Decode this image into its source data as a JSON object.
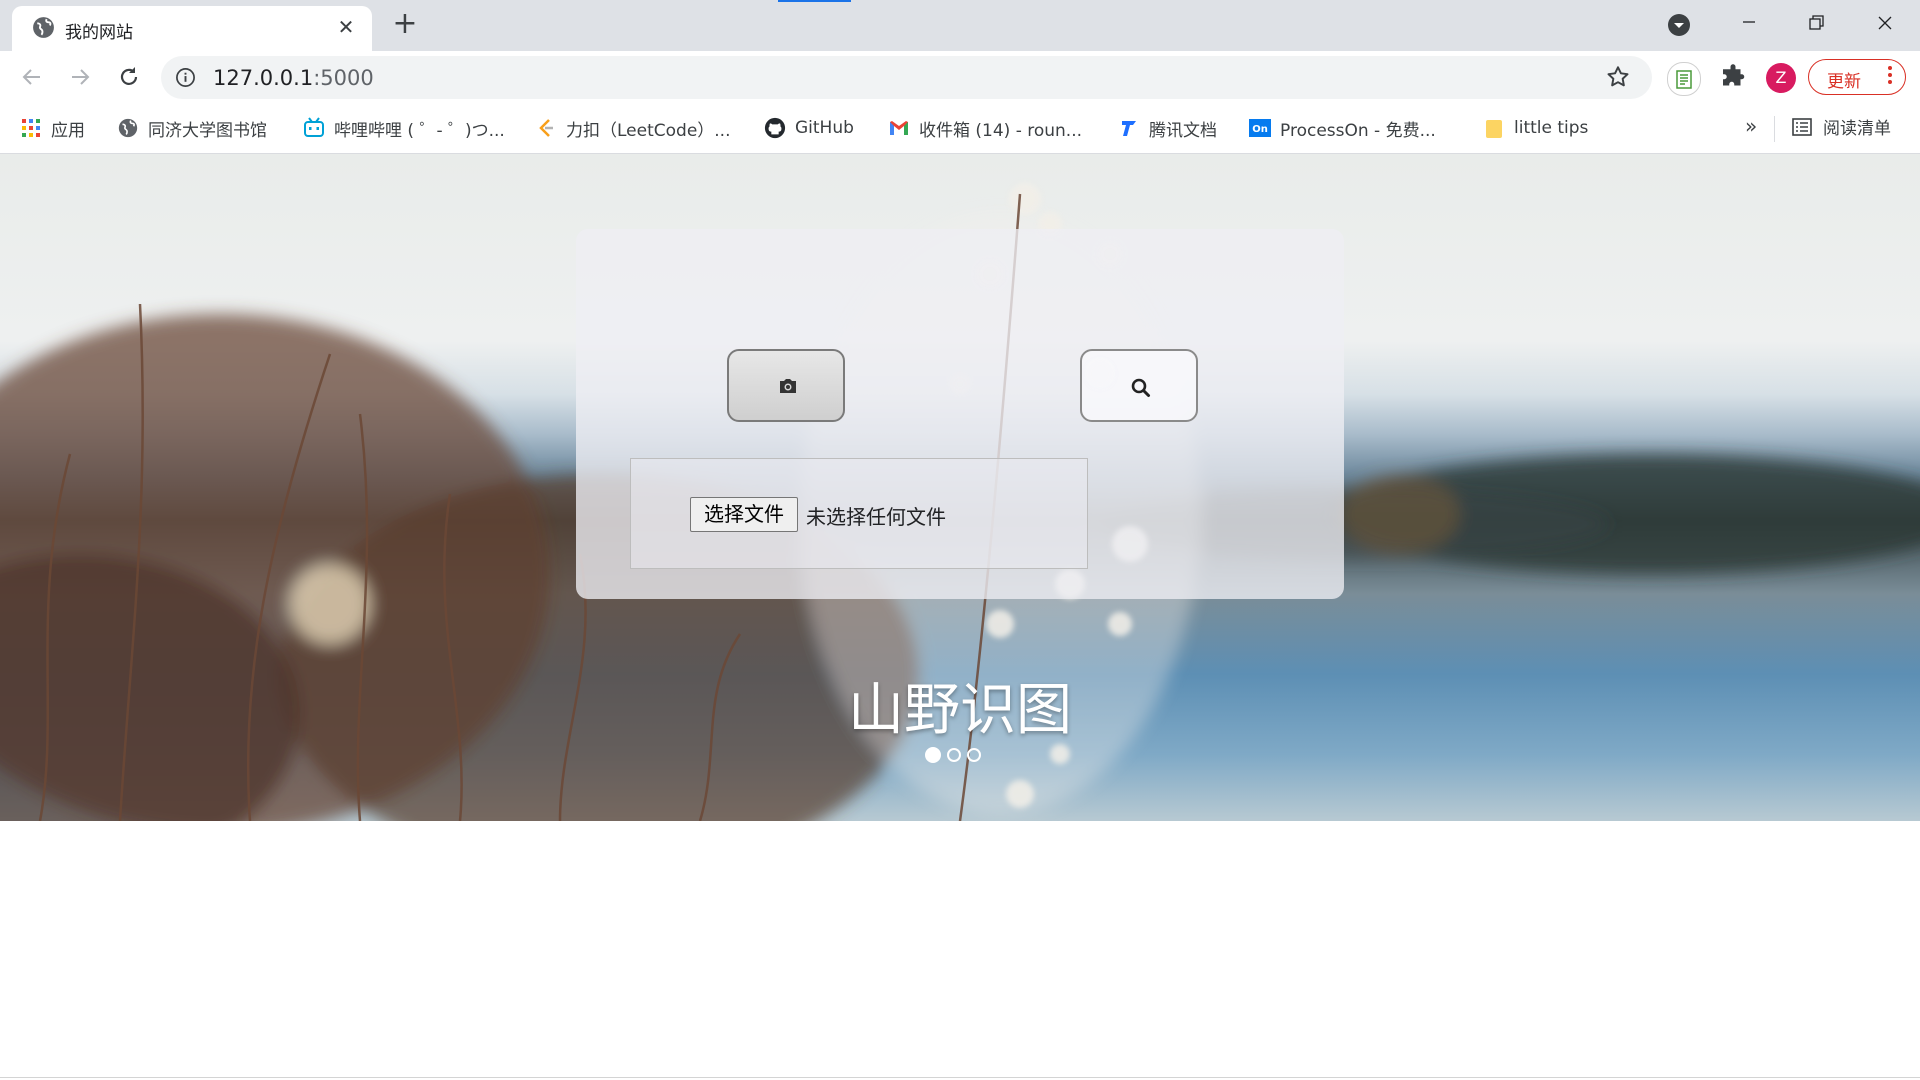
{
  "browser": {
    "tab": {
      "title": "我的网站",
      "close": "✕"
    },
    "new_tab": "+",
    "address": {
      "host": "127.0.0.1",
      "port": ":5000"
    },
    "avatar_letter": "Z",
    "update_label": "更新",
    "menu_dots": "⋮"
  },
  "bookmarks": {
    "items": [
      {
        "label": "应用",
        "icon": "apps-grid-icon"
      },
      {
        "label": "同济大学图书馆",
        "icon": "globe-icon"
      },
      {
        "label": "哔哩哔哩 ( ゜- ゜)つ...",
        "icon": "bilibili-icon"
      },
      {
        "label": "力扣（LeetCode）...",
        "icon": "leetcode-icon"
      },
      {
        "label": "GitHub",
        "icon": "github-icon"
      },
      {
        "label": "收件箱 (14) - roun...",
        "icon": "gmail-icon"
      },
      {
        "label": "腾讯文档",
        "icon": "tencent-docs-icon"
      },
      {
        "label": "ProcessOn - 免费...",
        "icon": "processon-icon"
      },
      {
        "label": "little tips",
        "icon": "folder-icon"
      }
    ],
    "more": "»",
    "reading_list": "阅读清单"
  },
  "page": {
    "file_input": {
      "button_label": "选择文件",
      "status": "未选择任何文件"
    },
    "title": "山野识图",
    "carousel": {
      "count": 3,
      "active": 1
    }
  },
  "colors": {
    "tabstrip": "#dee1e6",
    "accent_blue": "#1a73e8",
    "update_red": "#d93025",
    "avatar": "#d81b60"
  }
}
